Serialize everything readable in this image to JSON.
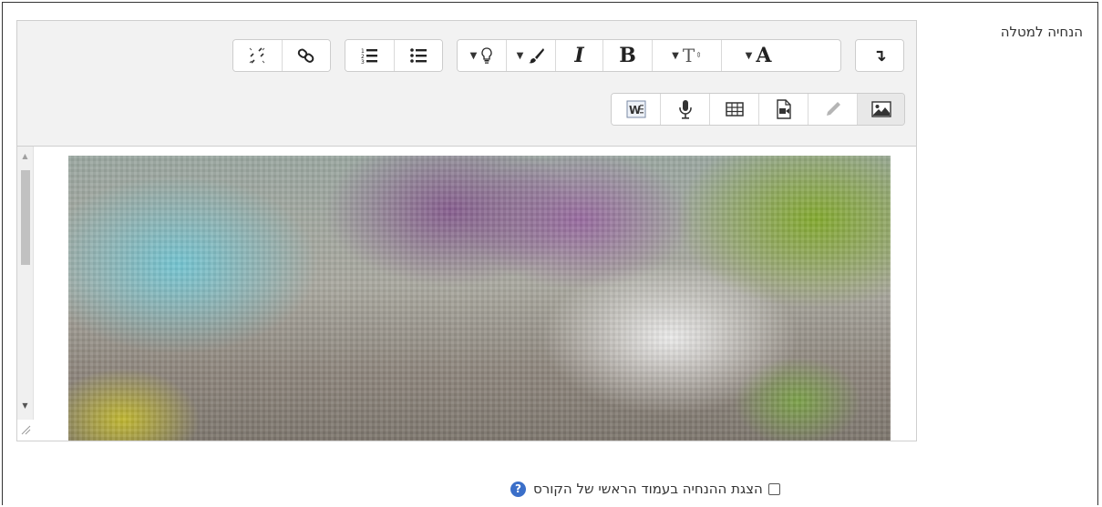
{
  "field": {
    "label": "הנחיה למטלה"
  },
  "toolbar": {
    "row1": {
      "expand": "↴",
      "font_color_caret": "▼",
      "font_color_label": "A",
      "font_size_caret": "▼",
      "font_size_label": "T",
      "bold_label": "B",
      "italic_label": "I",
      "highlight_caret": "▼",
      "emoji_caret": "▼"
    }
  },
  "content": {
    "image_alt": "blurred image"
  },
  "footer": {
    "show_on_course_page_label": "הצגת ההנחיה בעמוד הראשי של הקורס",
    "help_glyph": "?"
  },
  "colors": {
    "toolbar_bg": "#f2f2f2",
    "help_icon": "#3b6fc9"
  }
}
